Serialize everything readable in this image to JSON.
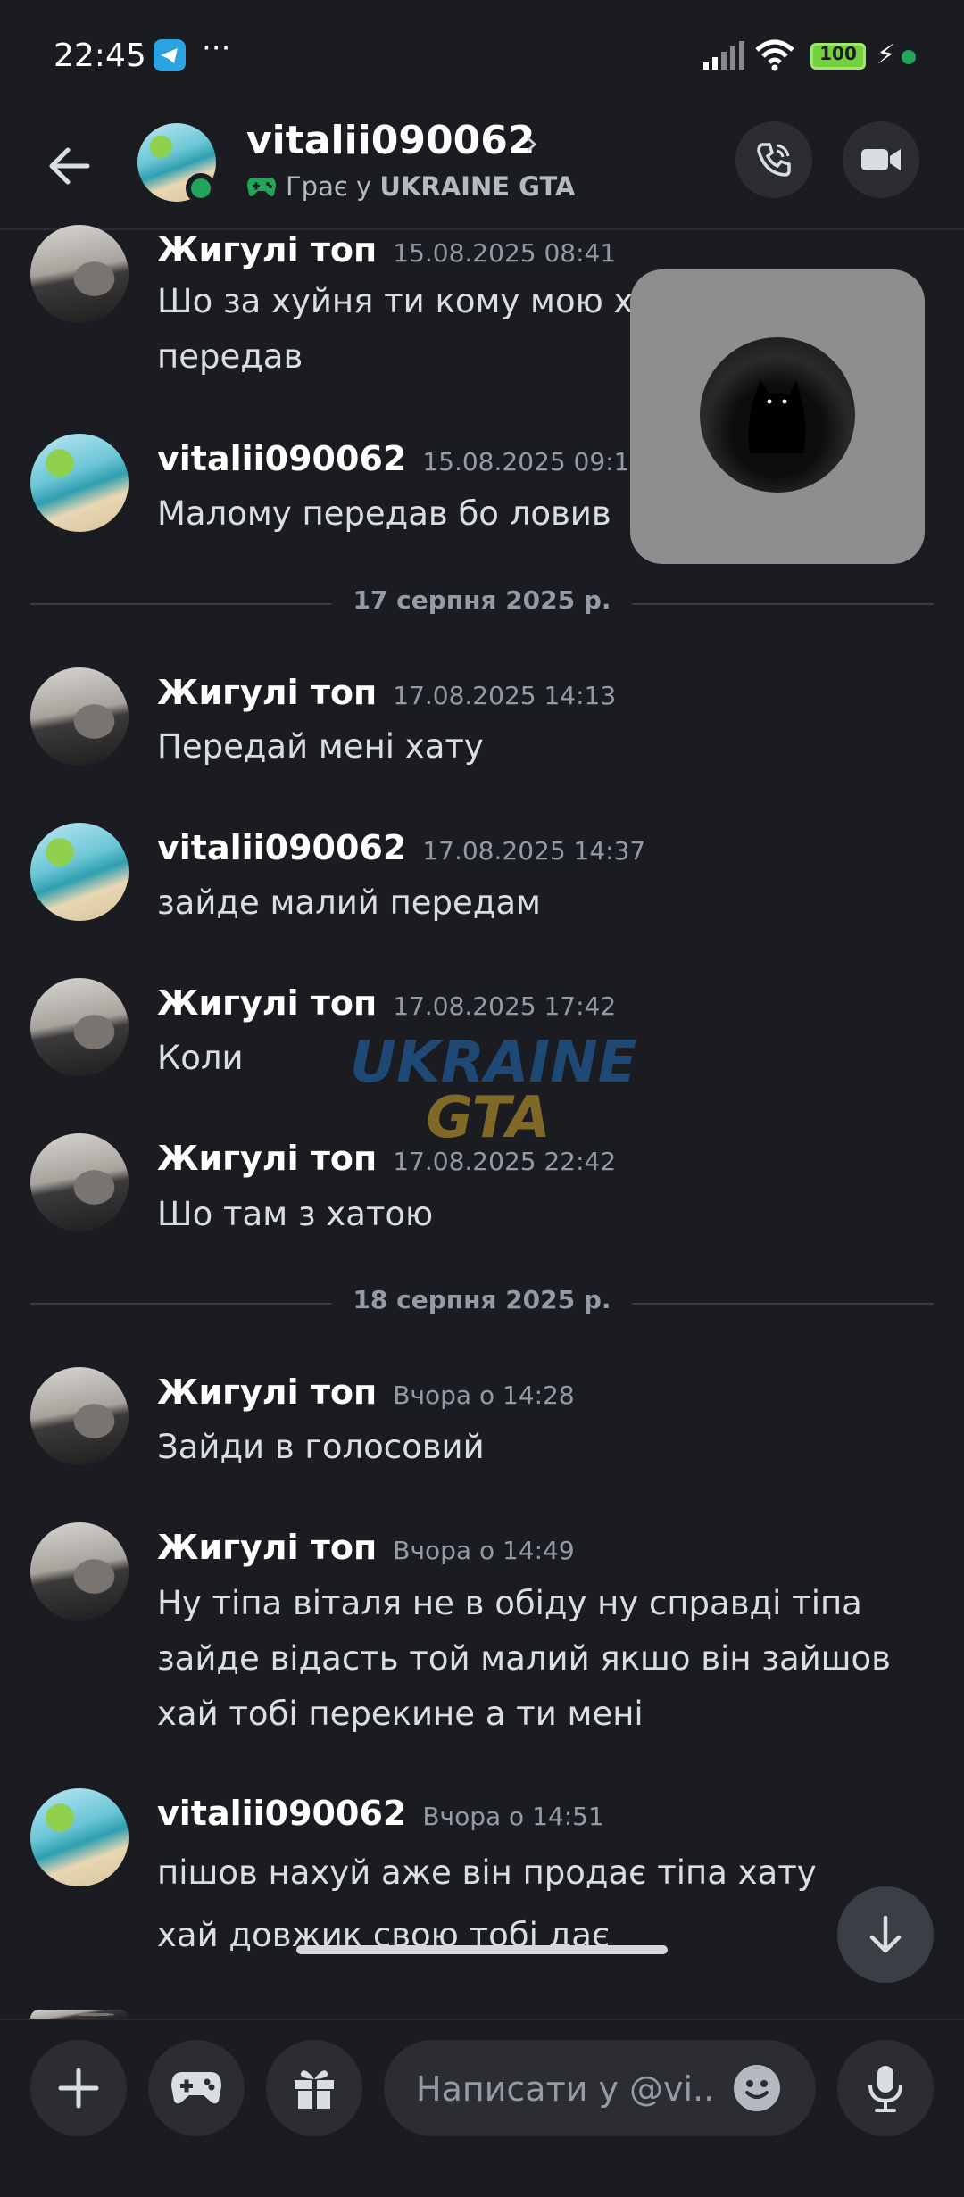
{
  "status_bar": {
    "time": "22:45",
    "dots": "···",
    "battery": "100",
    "colors": {
      "battery": "#73d13d",
      "telegram": "#2aa3e0"
    }
  },
  "header": {
    "name": "vitalii090062",
    "status_prefix": "Грає у ",
    "status_game": "UKRAINE GTA",
    "icons": [
      "back-arrow-icon",
      "phone-icon",
      "video-camera-icon"
    ]
  },
  "messages": [
    {
      "author": "Жигулі топ",
      "time": "15.08.2025 08:41",
      "text": "Шо за хуйня ти кому мою ха",
      "text2": "передав",
      "avatar": "car"
    },
    {
      "author": "vitalii090062",
      "time": "15.08.2025 09:19",
      "text": "Малому передав бо ловив",
      "avatar": "beach"
    },
    {
      "author": "Жигулі топ",
      "time": "17.08.2025 14:13",
      "text": "Передай мені хату",
      "avatar": "car"
    },
    {
      "author": "vitalii090062",
      "time": "17.08.2025 14:37",
      "text": "зайде малий передам",
      "avatar": "beach"
    },
    {
      "author": "Жигулі топ",
      "time": "17.08.2025 17:42",
      "text": "Коли",
      "avatar": "car"
    },
    {
      "author": "Жигулі топ",
      "time": "17.08.2025 22:42",
      "text": "Шо там з хатою",
      "avatar": "car"
    },
    {
      "author": "Жигулі топ",
      "time": "Вчора о 14:28",
      "text": "Зайди в голосовий",
      "avatar": "car"
    },
    {
      "author": "Жигулі топ",
      "time": "Вчора о 14:49",
      "text": "Ну тіпа віталя не в обіду ну справді тіпа",
      "text2": "зайде відасть той малий якшо він зайшов",
      "text3": "хай тобі перекине а ти мені",
      "avatar": "car"
    },
    {
      "author": "vitalii090062",
      "time": "Вчора о 14:51",
      "text": "пішов нахуй аже він продає тіпа хату",
      "text2": "хай довжик свою тобі дає",
      "avatar": "beach"
    }
  ],
  "dividers": [
    "17 серпня 2025 р.",
    "18 серпня 2025 р."
  ],
  "watermark": {
    "line1": "UKRAINE",
    "line2": "GTA"
  },
  "composer": {
    "placeholder": "Написати у @vi...",
    "icons": [
      "plus-icon",
      "gamepad-icon",
      "gift-icon",
      "emoji-icon",
      "microphone-icon"
    ]
  },
  "colors": {
    "background": "#1b1c22",
    "online": "#23a559",
    "timestamp": "#949ba4"
  }
}
